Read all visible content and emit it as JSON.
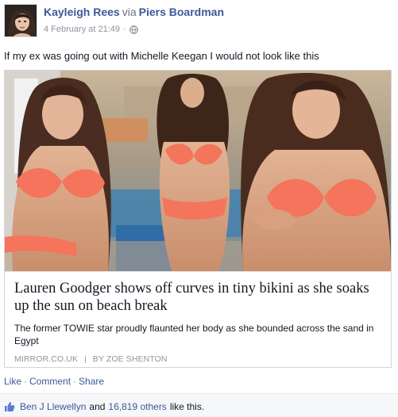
{
  "post": {
    "author": "Kayleigh Rees",
    "via_word": "via",
    "via_name": "Piers Boardman",
    "timestamp": "4 February at 21:49",
    "separator": "·",
    "privacy_icon": "globe-icon",
    "status_text": "If my ex was going out with Michelle Keegan I would not look like this"
  },
  "link_card": {
    "title": "Lauren Goodger shows off curves in tiny bikini as she soaks up the sun on beach break",
    "description": "The former TOWIE star proudly flaunted her body as she bounded across the sand in Egypt",
    "source": "MIRROR.CO.UK",
    "source_separator": "|",
    "byline": "BY ZOE SHENTON"
  },
  "actions": {
    "like": "Like",
    "comment": "Comment",
    "share": "Share",
    "dot": "·"
  },
  "likes": {
    "icon": "thumbs-up-icon",
    "first_liker": "Ben J Llewellyn",
    "and_text": "and",
    "others": "16,819 others",
    "suffix": "like this."
  },
  "colors": {
    "link_blue": "#3b5998",
    "meta_gray": "#90949c",
    "bikini_coral": "#f4745c",
    "likes_bar_bg": "#f6f7f9"
  }
}
